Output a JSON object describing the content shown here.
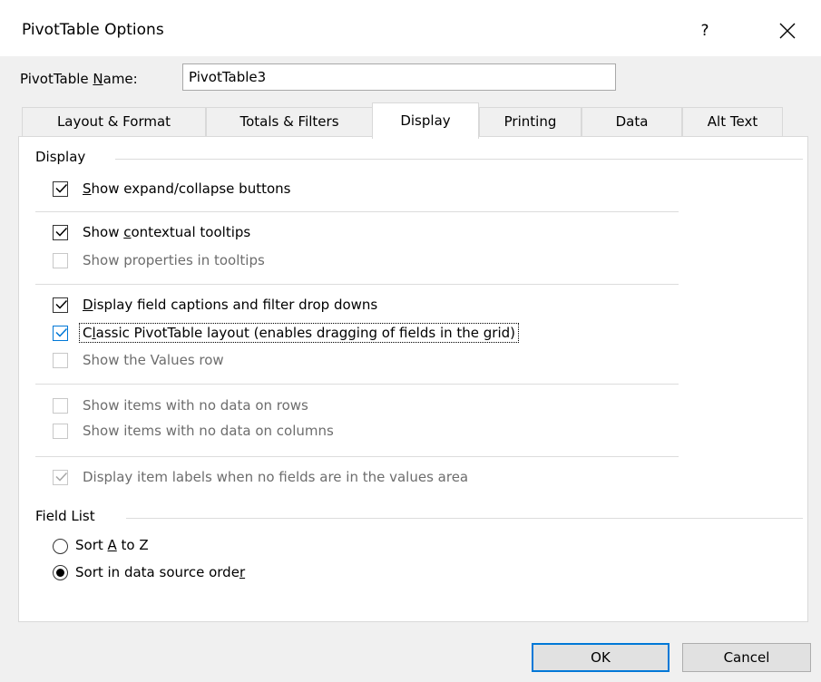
{
  "window": {
    "title": "PivotTable Options",
    "help_label": "?",
    "close_label": "✕"
  },
  "name_field": {
    "label_pre": "PivotTable ",
    "label_ul": "N",
    "label_post": "ame:",
    "value": "PivotTable3"
  },
  "tabs": [
    {
      "label": "Layout & Format",
      "active": false
    },
    {
      "label": "Totals & Filters",
      "active": false
    },
    {
      "label": "Display",
      "active": true
    },
    {
      "label": "Printing",
      "active": false
    },
    {
      "label": "Data",
      "active": false
    },
    {
      "label": "Alt Text",
      "active": false
    }
  ],
  "display_section": {
    "label": "Display",
    "options": [
      {
        "pre": "",
        "ul": "S",
        "post": "how expand/collapse buttons",
        "checked": true,
        "enabled": true
      },
      {
        "pre": "Show ",
        "ul": "c",
        "post": "ontextual tooltips",
        "checked": true,
        "enabled": true
      },
      {
        "pre": "Show properties in tooltips",
        "ul": "",
        "post": "",
        "checked": false,
        "enabled": false
      },
      {
        "pre": "",
        "ul": "D",
        "post": "isplay field captions and filter drop downs",
        "checked": true,
        "enabled": true
      },
      {
        "pre": "C",
        "ul": "l",
        "post": "assic PivotTable layout (enables dragging of fields in the grid)",
        "checked": true,
        "enabled": true,
        "focused": true
      },
      {
        "pre": "Show the Values row",
        "ul": "",
        "post": "",
        "checked": false,
        "enabled": false
      },
      {
        "pre": "Show items with no data on rows",
        "ul": "",
        "post": "",
        "checked": false,
        "enabled": false
      },
      {
        "pre": "Show items with no data on columns",
        "ul": "",
        "post": "",
        "checked": false,
        "enabled": false
      },
      {
        "pre": "Display item labels when no fields are in the values area",
        "ul": "",
        "post": "",
        "checked": true,
        "enabled": false
      }
    ]
  },
  "field_list_section": {
    "label": "Field List",
    "options": [
      {
        "pre": "Sort ",
        "ul": "A",
        "post": " to Z",
        "selected": false
      },
      {
        "pre": "Sort in data source orde",
        "ul": "r",
        "post": "",
        "selected": true
      }
    ]
  },
  "buttons": {
    "ok": "OK",
    "cancel": "Cancel"
  },
  "colors": {
    "accent": "#0078d7",
    "dialog_bg": "#f0f0f0",
    "disabled_text": "#6d6d6d"
  }
}
